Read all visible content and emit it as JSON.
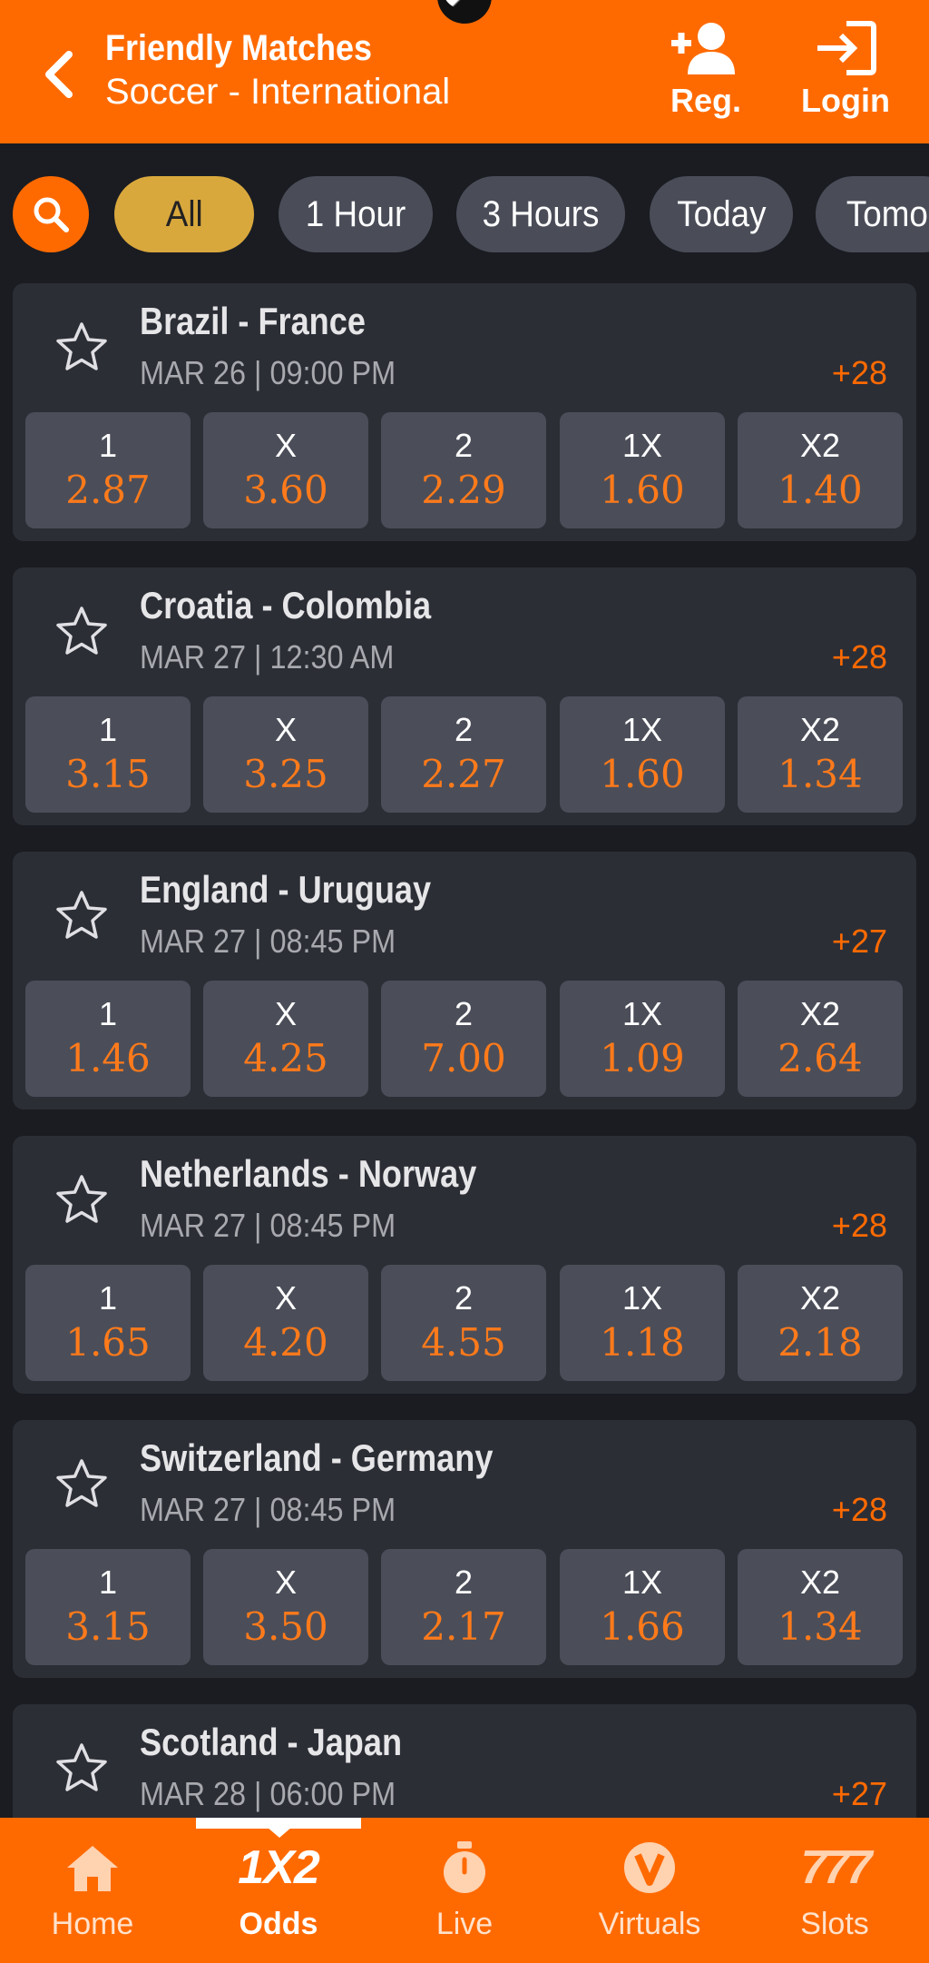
{
  "header": {
    "title": "Friendly Matches",
    "subtitle": "Soccer - International",
    "reg_label": "Reg.",
    "login_label": "Login"
  },
  "filters": [
    "All",
    "1 Hour",
    "3 Hours",
    "Today",
    "Tomo"
  ],
  "market_labels": [
    "1",
    "X",
    "2",
    "1X",
    "X2"
  ],
  "matches": [
    {
      "name": "Brazil - France",
      "time": "MAR 26 | 09:00 PM",
      "more": "+28",
      "odds": [
        "2.87",
        "3.60",
        "2.29",
        "1.60",
        "1.40"
      ]
    },
    {
      "name": "Croatia - Colombia",
      "time": "MAR 27 | 12:30 AM",
      "more": "+28",
      "odds": [
        "3.15",
        "3.25",
        "2.27",
        "1.60",
        "1.34"
      ]
    },
    {
      "name": "England - Uruguay",
      "time": "MAR 27 | 08:45 PM",
      "more": "+27",
      "odds": [
        "1.46",
        "4.25",
        "7.00",
        "1.09",
        "2.64"
      ]
    },
    {
      "name": "Netherlands - Norway",
      "time": "MAR 27 | 08:45 PM",
      "more": "+28",
      "odds": [
        "1.65",
        "4.20",
        "4.55",
        "1.18",
        "2.18"
      ]
    },
    {
      "name": "Switzerland - Germany",
      "time": "MAR 27 | 08:45 PM",
      "more": "+28",
      "odds": [
        "3.15",
        "3.50",
        "2.17",
        "1.66",
        "1.34"
      ]
    },
    {
      "name": "Scotland - Japan",
      "time": "MAR 28 | 06:00 PM",
      "more": "+27",
      "odds": []
    }
  ],
  "bottom_nav": {
    "home": "Home",
    "odds_icon_text": "1X2",
    "odds": "Odds",
    "live": "Live",
    "virtuals": "Virtuals",
    "slots_icon_text": "777",
    "slots": "Slots"
  },
  "colors": {
    "accent": "#ff6a00",
    "active_chip": "#d9a83d",
    "odds_value": "#ff7a1a",
    "card_bg": "#2c2e36",
    "background": "#1a1c22"
  }
}
